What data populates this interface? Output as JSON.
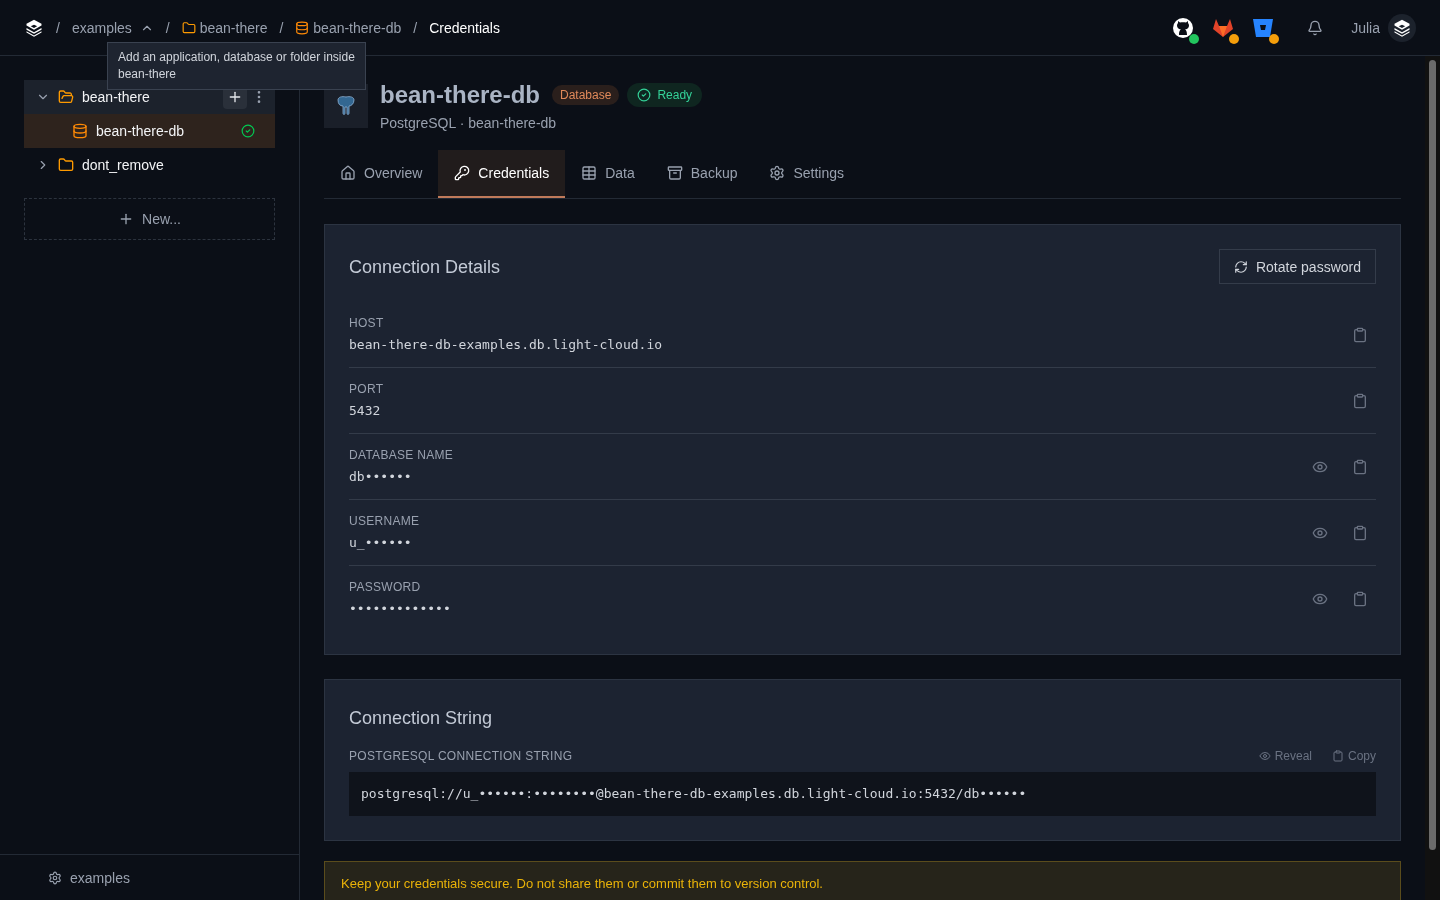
{
  "breadcrumb_separator": "/",
  "breadcrumb": [
    {
      "label": "examples",
      "kind": "org"
    },
    {
      "label": "bean-there",
      "kind": "folder"
    },
    {
      "label": "bean-there-db",
      "kind": "database"
    },
    {
      "label": "Credentials",
      "kind": "current"
    }
  ],
  "tooltip": "Add an application, database or folder inside bean-there",
  "header": {
    "integrations": [
      {
        "kind": "github",
        "color": "#22c55e"
      },
      {
        "kind": "gitlab",
        "color": "#f59e0b"
      },
      {
        "kind": "bitbucket",
        "color": "#f59e0b"
      }
    ],
    "user": "Julia"
  },
  "sidebar": {
    "tree": [
      {
        "label": "bean-there",
        "kind": "folder",
        "expanded": true,
        "hovered": true,
        "children": [
          {
            "label": "bean-there-db",
            "kind": "database",
            "selected": true,
            "ready": true
          }
        ]
      },
      {
        "label": "dont_remove",
        "kind": "folder",
        "expanded": false,
        "hovered": false
      }
    ],
    "new_button": "New...",
    "footer": "examples"
  },
  "resource": {
    "title": "bean-there-db",
    "type_badge": "Database",
    "status": "Ready",
    "subtitle": "PostgreSQL · bean-there-db"
  },
  "tabs": [
    {
      "label": "Overview",
      "selected": false
    },
    {
      "label": "Credentials",
      "selected": true
    },
    {
      "label": "Data",
      "selected": false
    },
    {
      "label": "Backup",
      "selected": false
    },
    {
      "label": "Settings",
      "selected": false
    }
  ],
  "connection_details": {
    "title": "Connection Details",
    "rotate_button": "Rotate password",
    "fields": [
      {
        "label": "HOST",
        "value": "bean-there-db-examples.db.light-cloud.io",
        "revealable": false
      },
      {
        "label": "PORT",
        "value": "5432",
        "revealable": false
      },
      {
        "label": "DATABASE NAME",
        "value": "db••••••",
        "revealable": true
      },
      {
        "label": "USERNAME",
        "value": "u_••••••",
        "revealable": true
      },
      {
        "label": "PASSWORD",
        "value": "•••••••••••••",
        "revealable": true
      }
    ]
  },
  "connection_string": {
    "title": "Connection String",
    "label": "POSTGRESQL CONNECTION STRING",
    "reveal": "Reveal",
    "copy": "Copy",
    "value": "postgresql://u_••••••:••••••••@bean-there-db-examples.db.light-cloud.io:5432/db••••••"
  },
  "warning": "Keep your credentials secure. Do not share them or commit them to version control."
}
